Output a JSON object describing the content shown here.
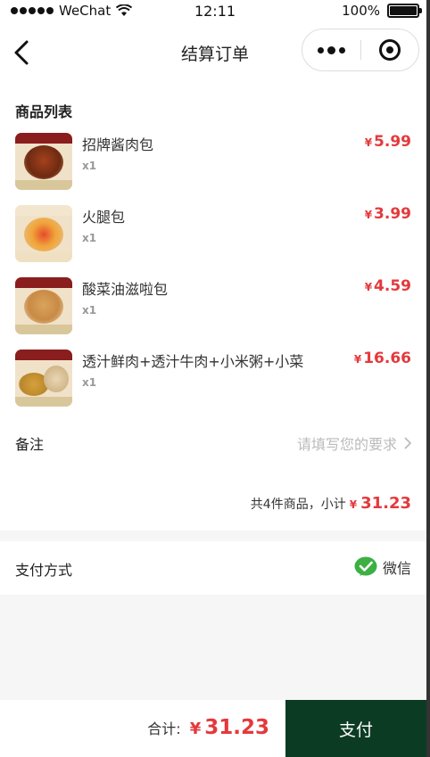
{
  "status_bar": {
    "carrier": "WeChat",
    "time": "12:11",
    "battery": "100%",
    "battery_level": 1.0
  },
  "nav": {
    "title": "结算订单",
    "back_icon": "chevron-left-icon",
    "more_icon": "more-dots-icon",
    "close_icon": "target-circle-icon"
  },
  "product_list": {
    "title": "商品列表",
    "items": [
      {
        "name": "招牌酱肉包",
        "qty": "x1",
        "currency": "¥",
        "price": "5.99"
      },
      {
        "name": "火腿包",
        "qty": "x1",
        "currency": "¥",
        "price": "3.99"
      },
      {
        "name": "酸菜油滋啦包",
        "qty": "x1",
        "currency": "¥",
        "price": "4.59"
      },
      {
        "name": "透汁鲜肉+透汁牛肉+小米粥+小菜",
        "qty": "x1",
        "currency": "¥",
        "price": "16.66"
      }
    ]
  },
  "remark": {
    "label": "备注",
    "placeholder": "请填写您的要求"
  },
  "subtotal": {
    "label": "共4件商品，小计",
    "currency": "¥",
    "amount": "31.23"
  },
  "payment": {
    "label": "支付方式",
    "method": "微信",
    "method_icon": "wechat-pay-icon"
  },
  "footer": {
    "total_label": "合计:",
    "currency": "¥",
    "total": "31.23",
    "pay_button": "支付"
  },
  "colors": {
    "price": "#e4393c",
    "pay_button_bg": "#0c3b24",
    "wechat_green": "#3cb043"
  }
}
